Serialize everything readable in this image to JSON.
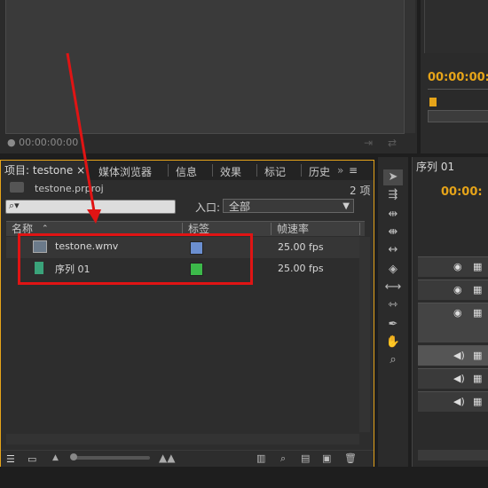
{
  "source_monitor": {
    "timecode": "00:00:00:00"
  },
  "program_monitor": {
    "timecode": "00:00:00:0"
  },
  "project_panel": {
    "tabs": [
      "项目: testone",
      "媒体浏览器",
      "信息",
      "效果",
      "标记",
      "历史"
    ],
    "close_glyph": "×",
    "project_file": "testone.prproj",
    "item_count": "2 项",
    "search_placeholder": "",
    "in_point_label": "入口:",
    "in_point_value": "全部",
    "columns": [
      "名称",
      "标签",
      "帧速率"
    ],
    "items": [
      {
        "name": "testone.wmv",
        "label_color": "#6b8fd0",
        "fps": "25.00 fps",
        "icon": "video-clip-icon"
      },
      {
        "name": "序列 01",
        "label_color": "#3cb94a",
        "fps": "25.00 fps",
        "icon": "sequence-icon"
      }
    ]
  },
  "timeline": {
    "tab": "序列 01",
    "timecode": "00:00:"
  },
  "colors": {
    "accent": "#e6a419",
    "annotation_red": "#e01414"
  }
}
